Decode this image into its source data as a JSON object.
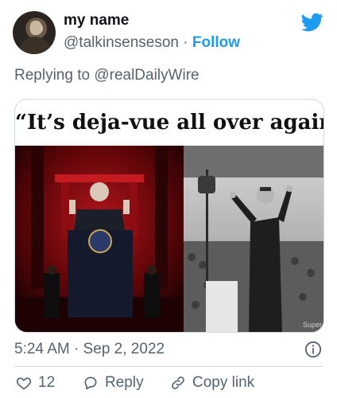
{
  "author": {
    "name": "my name",
    "handle": "@talkinsenseson",
    "separator": "·",
    "follow_label": "Follow"
  },
  "replying_to": "Replying to @realDailyWire",
  "media": {
    "quote_text": "“It’s deja-vue all over again.”",
    "watermark": "Super"
  },
  "timestamp": "5:24 AM · Sep 2, 2022",
  "actions": {
    "like_count": "12",
    "reply_label": "Reply",
    "copy_link_label": "Copy link"
  },
  "colors": {
    "accent": "#1d9bf0",
    "secondary_text": "#536471",
    "border": "#cfd9de"
  },
  "icons": [
    "twitter-bird-icon",
    "info-icon",
    "heart-icon",
    "reply-icon",
    "link-icon"
  ]
}
